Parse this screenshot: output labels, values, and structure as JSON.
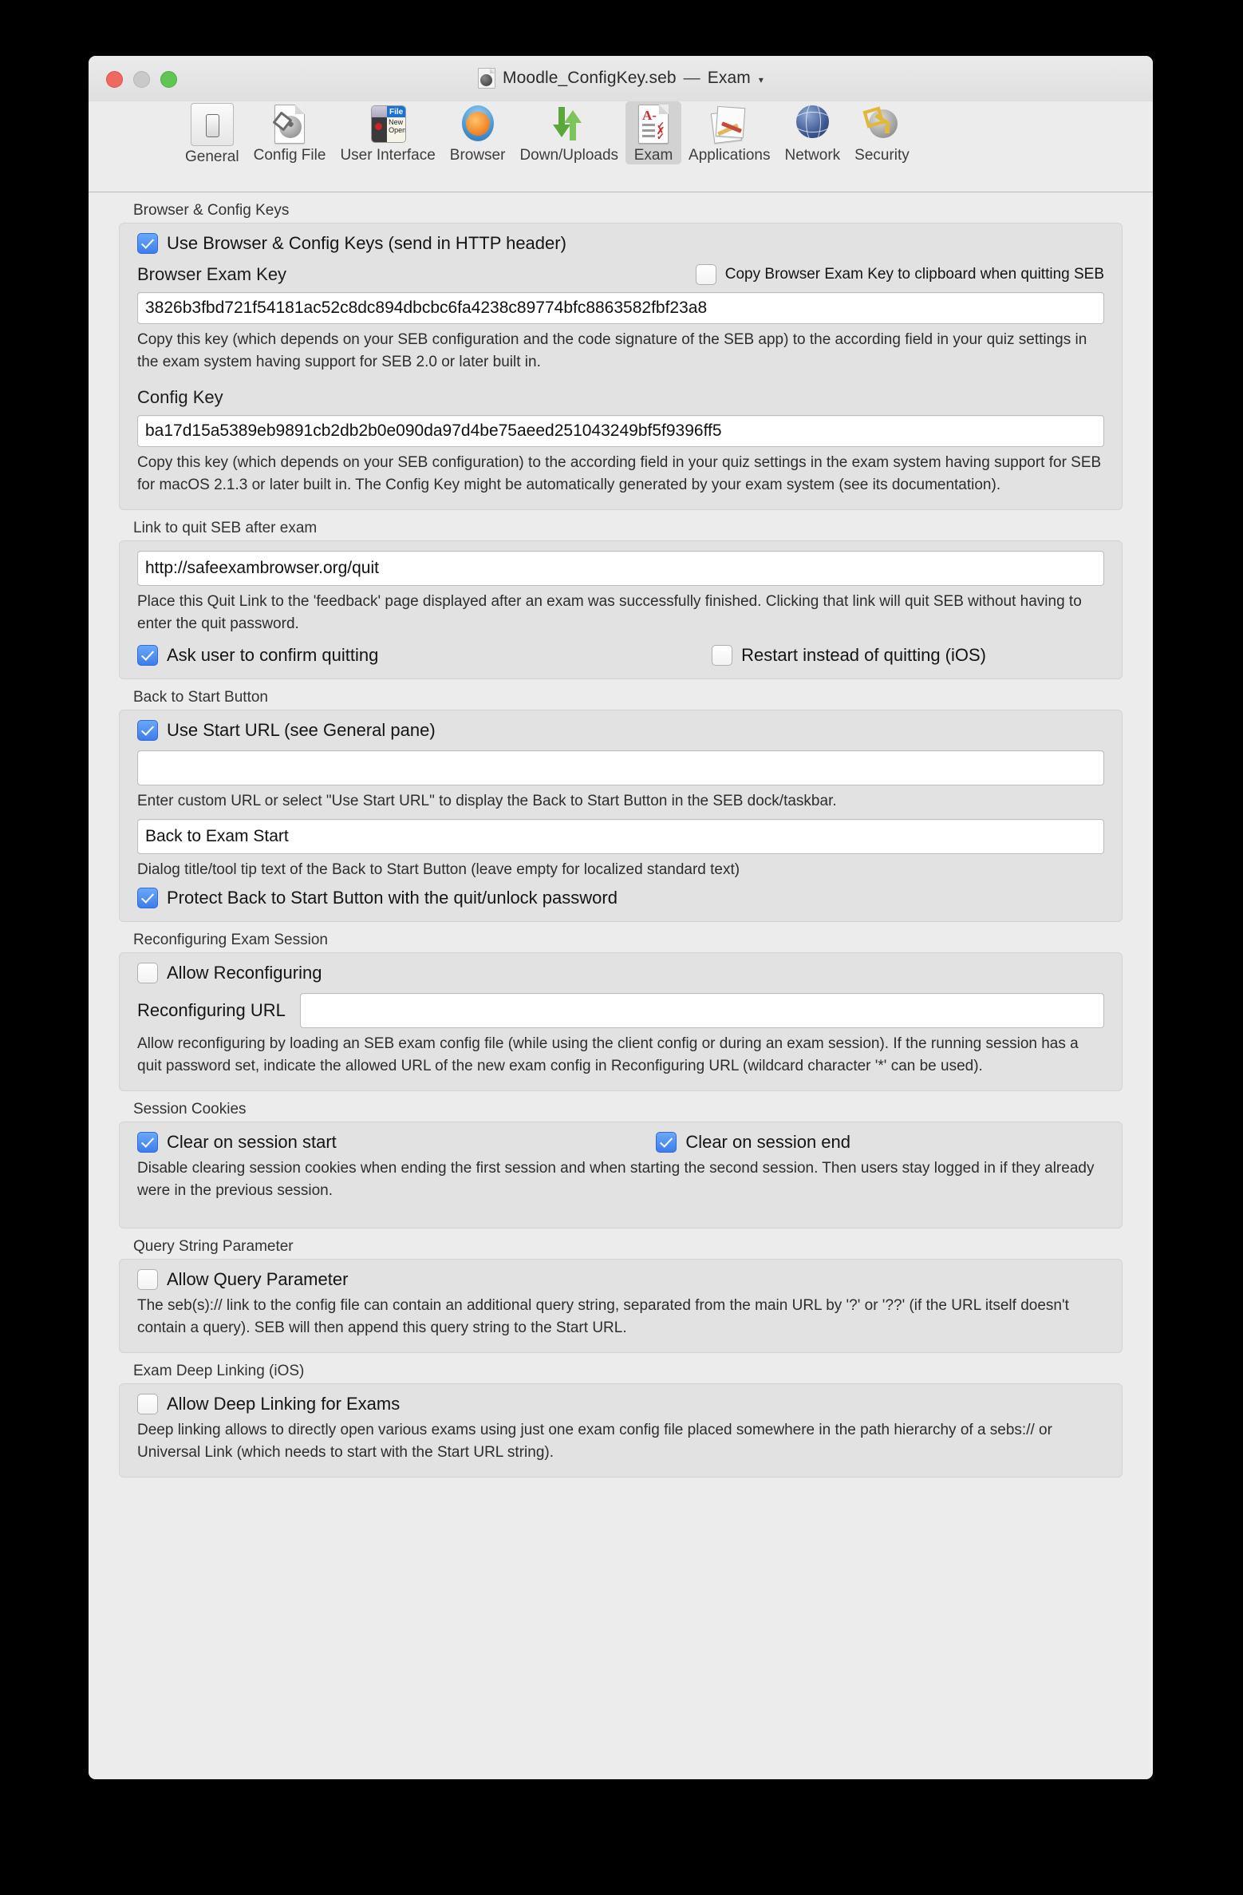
{
  "window": {
    "title_file": "Moodle_ConfigKey.seb",
    "title_separator": "—",
    "title_pane": "Exam",
    "title_chevron": "▾"
  },
  "toolbar": {
    "items": [
      {
        "label": "General",
        "icon": "switch-icon",
        "selected": false
      },
      {
        "label": "Config File",
        "icon": "config-file-icon",
        "selected": false
      },
      {
        "label": "User Interface",
        "icon": "user-interface-icon",
        "selected": false
      },
      {
        "label": "Browser",
        "icon": "browser-globe-icon",
        "selected": false
      },
      {
        "label": "Down/Uploads",
        "icon": "up-down-arrows-icon",
        "selected": false
      },
      {
        "label": "Exam",
        "icon": "exam-paper-icon",
        "selected": true
      },
      {
        "label": "Applications",
        "icon": "applications-icon",
        "selected": false
      },
      {
        "label": "Network",
        "icon": "network-globe-icon",
        "selected": false
      },
      {
        "label": "Security",
        "icon": "security-key-icon",
        "selected": false
      }
    ]
  },
  "sections": {
    "keys": {
      "title": "Browser & Config Keys",
      "use_keys_label": "Use Browser & Config Keys (send in HTTP header)",
      "use_keys_checked": true,
      "bek_label": "Browser Exam Key",
      "copy_bek_label": "Copy Browser Exam Key to clipboard when quitting SEB",
      "copy_bek_checked": false,
      "bek_value": "3826b3fbd721f54181ac52c8dc894dbcbc6fa4238c89774bfc8863582fbf23a8",
      "bek_desc": "Copy this key (which depends on your SEB configuration and the code signature of the SEB app) to the according field in your quiz settings in the exam system having support for SEB 2.0 or later built in.",
      "ck_label": "Config Key",
      "ck_value": "ba17d15a5389eb9891cb2db2b0e090da97d4be75aeed251043249bf5f9396ff5",
      "ck_desc": "Copy this key (which depends on your SEB configuration) to the according field in your quiz settings in the exam system having support for SEB for macOS 2.1.3 or later built in. The Config Key might be automatically generated by your exam system (see its documentation)."
    },
    "quit_link": {
      "title": "Link to quit SEB after exam",
      "url_value": "http://safeexambrowser.org/quit",
      "url_placeholder": "",
      "desc": "Place this Quit Link to the 'feedback' page displayed after an exam was successfully finished. Clicking that link will quit SEB without having to enter the quit password.",
      "ask_confirm_label": "Ask user to confirm quitting",
      "ask_confirm_checked": true,
      "restart_label": "Restart instead of quitting (iOS)",
      "restart_checked": false
    },
    "back_to_start": {
      "title": "Back to Start Button",
      "use_start_url_label": "Use Start URL (see General pane)",
      "use_start_url_checked": true,
      "custom_url_value": "",
      "custom_url_placeholder": "",
      "custom_url_desc": "Enter custom URL or select \"Use Start URL\" to display the Back to Start Button in the SEB dock/taskbar.",
      "tooltip_value": "Back to Exam Start",
      "tooltip_desc": "Dialog title/tool tip text of the Back to Start Button (leave empty for localized standard text)",
      "protect_label": "Protect Back to Start Button with the quit/unlock password",
      "protect_checked": true
    },
    "reconfiguring": {
      "title": "Reconfiguring Exam Session",
      "allow_label": "Allow Reconfiguring",
      "allow_checked": false,
      "url_label": "Reconfiguring URL",
      "url_value": "",
      "desc": "Allow reconfiguring by loading an SEB exam config file (while using the client config or during an exam session). If the running session has a quit password set, indicate the allowed URL of the new exam config in Reconfiguring URL (wildcard character '*' can be used)."
    },
    "session_cookies": {
      "title": "Session Cookies",
      "clear_start_label": "Clear on session start",
      "clear_start_checked": true,
      "clear_end_label": "Clear on session end",
      "clear_end_checked": true,
      "desc": "Disable clearing session cookies when ending the first session and when starting the second session. Then users stay logged in if they already were in the previous session."
    },
    "query_string": {
      "title": "Query String Parameter",
      "allow_label": "Allow Query Parameter",
      "allow_checked": false,
      "desc": "The seb(s):// link to the config file can contain an additional query string, separated from the main URL by '?' or '??' (if the URL itself doesn't contain a query). SEB will then append this query string to the Start URL."
    },
    "deep_linking": {
      "title": "Exam Deep Linking (iOS)",
      "allow_label": "Allow Deep Linking for Exams",
      "allow_checked": false,
      "desc": "Deep linking allows to directly open various exams using just one exam config file placed somewhere in the path hierarchy of a sebs:// or Universal Link (which needs to start with the Start URL string)."
    }
  },
  "colors": {
    "accent": "#3d7ded",
    "window_bg": "#ececec",
    "group_bg": "#e2e2e2"
  }
}
